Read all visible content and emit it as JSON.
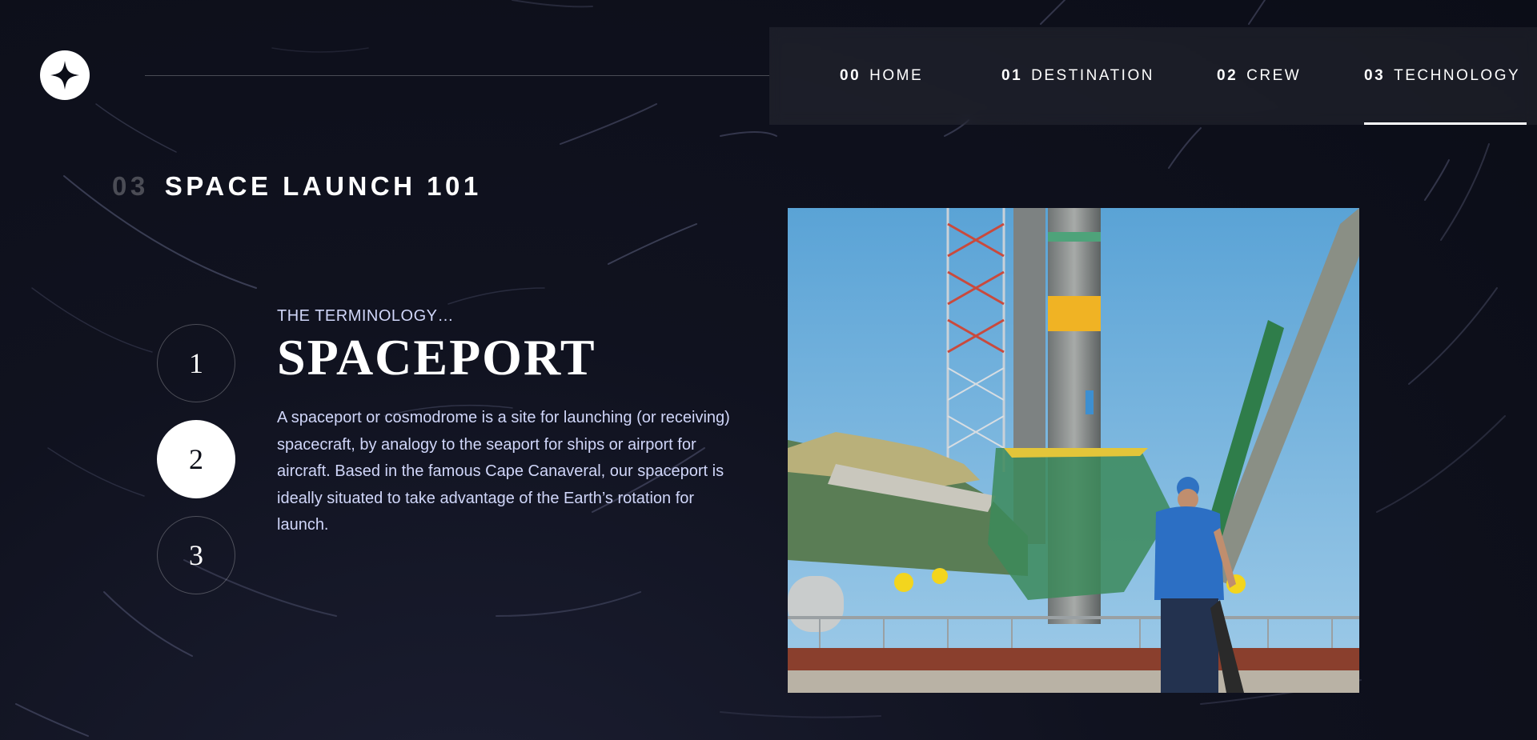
{
  "header": {
    "logo_icon": "four-point-star-icon",
    "nav": [
      {
        "number": "00",
        "label": "HOME",
        "active": false
      },
      {
        "number": "01",
        "label": "DESTINATION",
        "active": false
      },
      {
        "number": "02",
        "label": "CREW",
        "active": false
      },
      {
        "number": "03",
        "label": "TECHNOLOGY",
        "active": true
      }
    ]
  },
  "page": {
    "heading_number": "03",
    "heading_text": "SPACE LAUNCH 101"
  },
  "stepper": {
    "steps": [
      "1",
      "2",
      "3"
    ],
    "active_index": 1
  },
  "technology": {
    "eyebrow": "THE TERMINOLOGY…",
    "name": "SPACEPORT",
    "description": "A spaceport or cosmodrome is a site for launching (or receiving) spacecraft, by analogy to the seaport for ships or airport for aircraft. Based in the famous Cape Canaveral, our spaceport is ideally situated to take advantage of the Earth’s rotation for launch.",
    "image_subject": "rocket-launch-pad-photo"
  },
  "colors": {
    "background": "#0b0d17",
    "text_secondary": "#d0d6f9",
    "white": "#ffffff"
  }
}
